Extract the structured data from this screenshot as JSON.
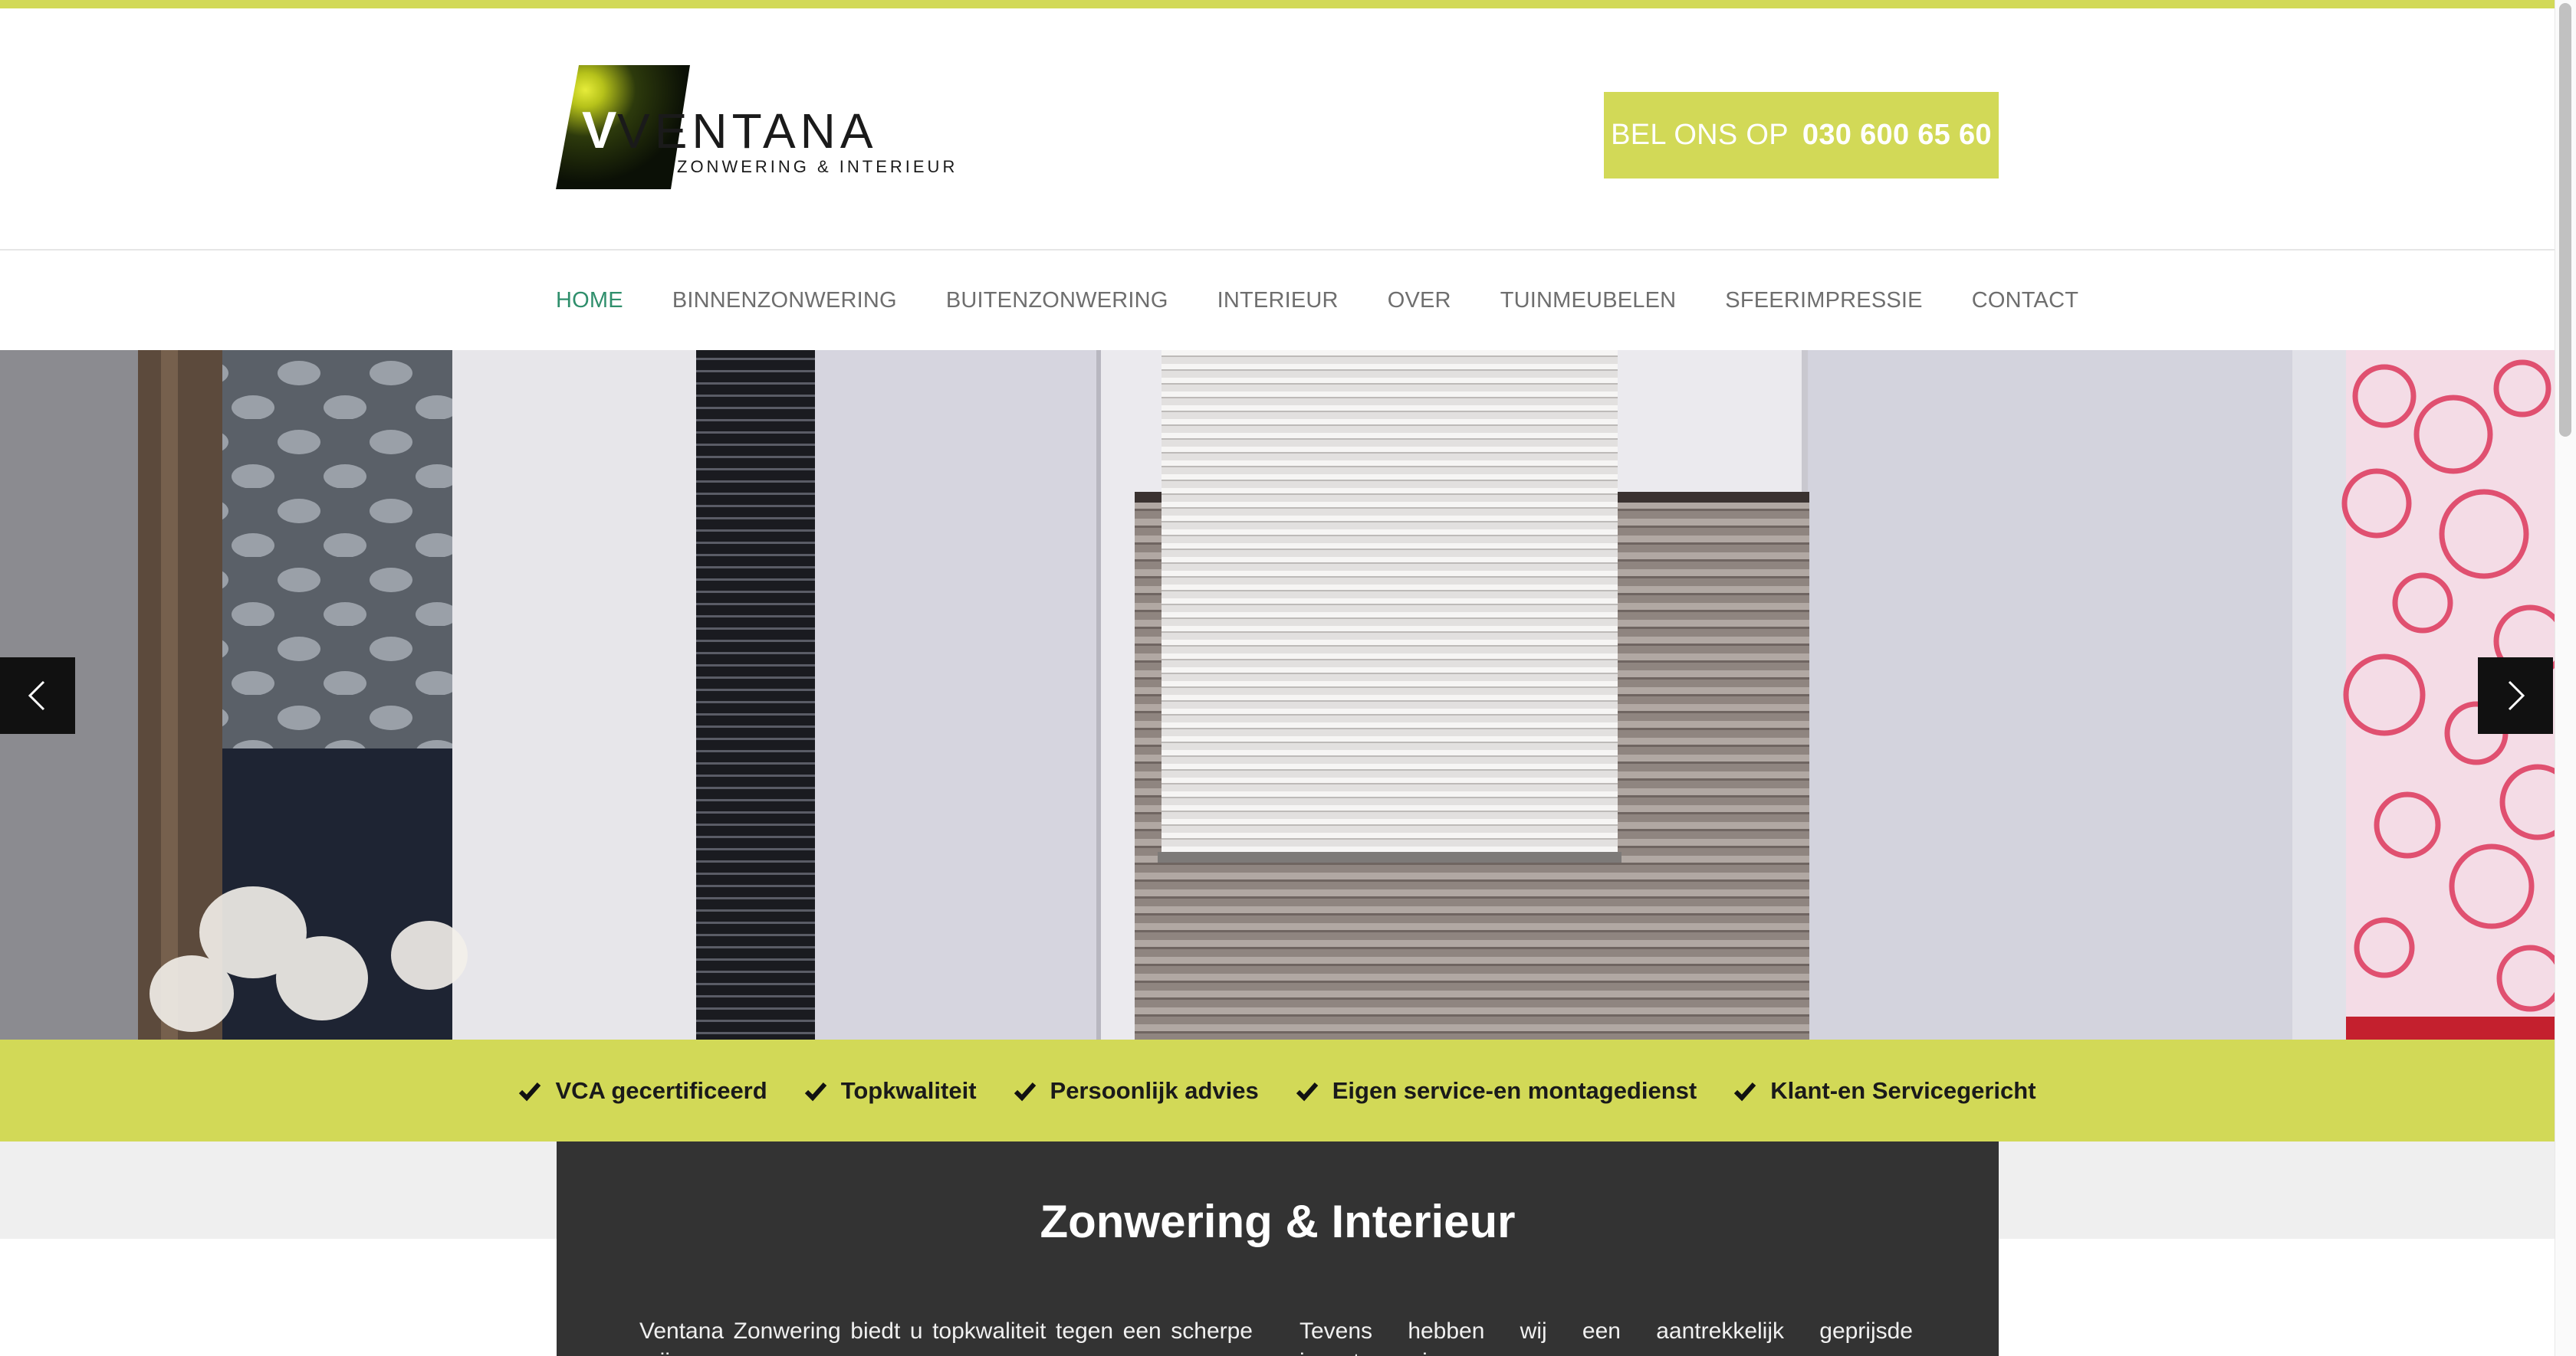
{
  "brand": {
    "name": "VENTANA",
    "tagline": "ZONWERING & INTERIEUR"
  },
  "header": {
    "phone_label": "BEL ONS OP",
    "phone_number": "030 600 65 60"
  },
  "nav": {
    "items": [
      {
        "label": "HOME",
        "active": true
      },
      {
        "label": "BINNENZONWERING",
        "active": false
      },
      {
        "label": "BUITENZONWERING",
        "active": false
      },
      {
        "label": "INTERIEUR",
        "active": false
      },
      {
        "label": "OVER",
        "active": false
      },
      {
        "label": "TUINMEUBELEN",
        "active": false
      },
      {
        "label": "SFEERIMPRESSIE",
        "active": false
      },
      {
        "label": "CONTACT",
        "active": false
      }
    ]
  },
  "slider": {
    "prev_icon": "chevron-left-icon",
    "next_icon": "chevron-right-icon"
  },
  "features": [
    {
      "icon": "check-icon",
      "label": "VCA gecertificeerd"
    },
    {
      "icon": "check-icon",
      "label": "Topkwaliteit"
    },
    {
      "icon": "check-icon",
      "label": "Persoonlijk advies"
    },
    {
      "icon": "check-icon",
      "label": "Eigen service-en montagedienst"
    },
    {
      "icon": "check-icon",
      "label": "Klant-en Servicegericht"
    }
  ],
  "content": {
    "title": "Zonwering & Interieur",
    "col_left": "Ventana Zonwering biedt u topkwaliteit tegen een scherpe prijs",
    "col_right": "Tevens hebben wij een aantrekkelijk geprijsde insectenwering"
  },
  "colors": {
    "accent": "#d2d957",
    "nav_active": "#2f8f6c",
    "dark_box": "#333333"
  }
}
